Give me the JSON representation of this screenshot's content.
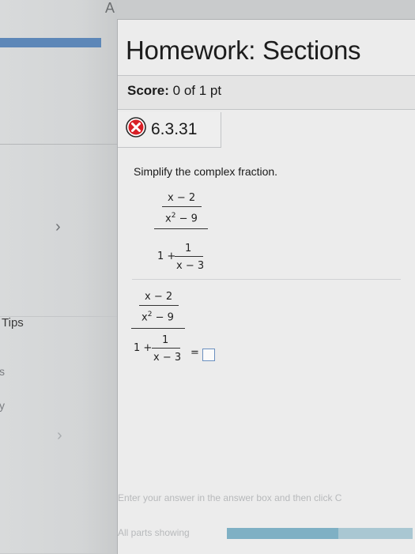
{
  "tab_letter": "A",
  "sidebar": {
    "tips_label": "Tips",
    "fragment_s": "s",
    "fragment_y": "y"
  },
  "header": {
    "title": "Homework: Sections",
    "score_label": "Score:",
    "score_value": "0 of 1 pt"
  },
  "question": {
    "number": "6.3.31",
    "status": "incorrect",
    "instruction": "Simplify the complex fraction."
  },
  "math": {
    "num_top": "x − 2",
    "num_bottom_base": "x",
    "num_bottom_exp": "2",
    "num_bottom_rest": " − 9",
    "den_lead": "1 +",
    "den_top": "1",
    "den_bottom": "x − 3",
    "equals": "="
  },
  "footer": {
    "instruction": "Enter your answer in the answer box and then click C",
    "parts_label": "All parts showing",
    "progress": 0.6
  },
  "colors": {
    "error_red": "#d81f26",
    "answer_box_border": "#6a8fbf",
    "progress": "#7fb0c4"
  }
}
